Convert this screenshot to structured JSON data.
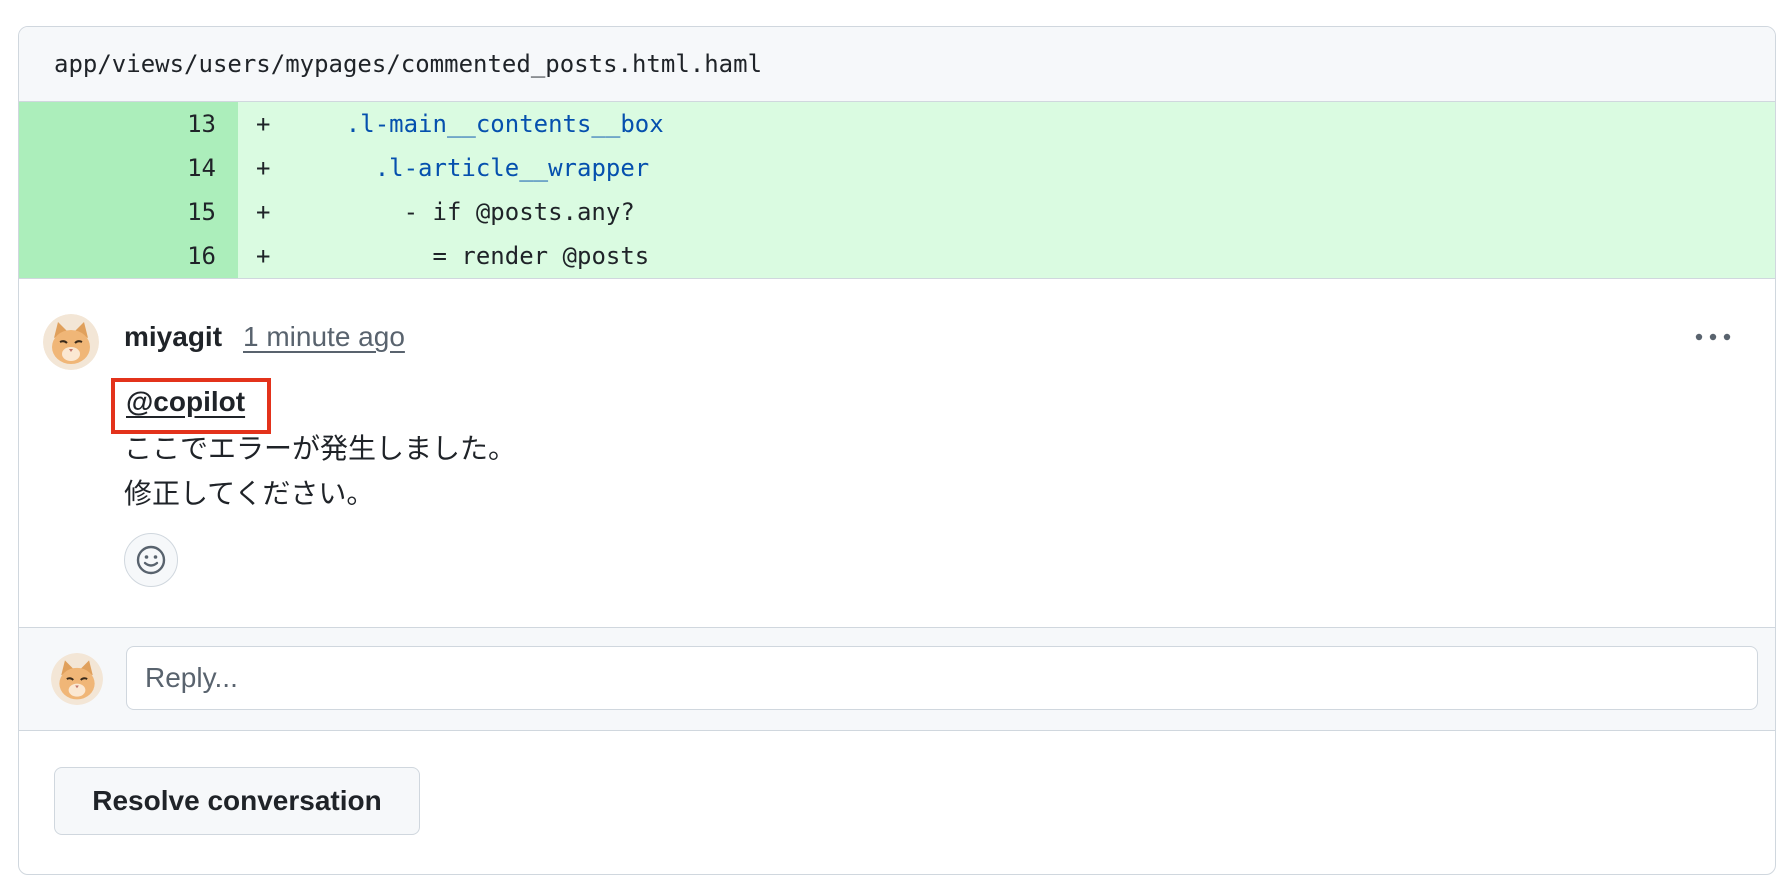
{
  "file": {
    "path": "app/views/users/mypages/commented_posts.html.haml"
  },
  "diff": {
    "lines": [
      {
        "number": "13",
        "marker": "+",
        "indent": "    ",
        "code": ".l-main__contents__box",
        "kind": "class"
      },
      {
        "number": "14",
        "marker": "+",
        "indent": "      ",
        "code": ".l-article__wrapper",
        "kind": "class"
      },
      {
        "number": "15",
        "marker": "+",
        "indent": "        ",
        "code": "- if @posts.any?",
        "kind": "code"
      },
      {
        "number": "16",
        "marker": "+",
        "indent": "          ",
        "code": "= render @posts",
        "kind": "code"
      }
    ]
  },
  "comment": {
    "author": "miyagit",
    "time": "1 minute ago",
    "mention": "@copilot",
    "lines": [
      "ここでエラーが発生しました。",
      "修正してください。"
    ],
    "avatar_icon": "cat-avatar",
    "more_icon": "kebab-horizontal-icon",
    "reaction_icon": "smiley-icon"
  },
  "reply": {
    "placeholder": "Reply..."
  },
  "actions": {
    "resolve_label": "Resolve conversation"
  },
  "colors": {
    "addition_line_number_bg": "#aceebb",
    "addition_code_bg": "#dafbe1",
    "class_token": "#0550ae",
    "highlight_border": "#e3321b",
    "muted_text": "#59636e"
  }
}
